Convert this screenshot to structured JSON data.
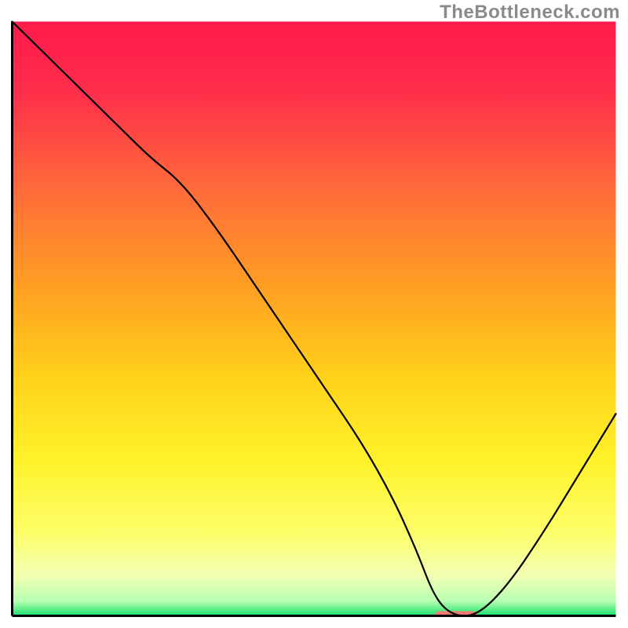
{
  "watermark": "TheBottleneck.com",
  "chart_data": {
    "type": "line",
    "title": "",
    "xlabel": "",
    "ylabel": "",
    "xlim": [
      0,
      100
    ],
    "ylim": [
      0,
      100
    ],
    "grid": false,
    "legend": false,
    "background_gradient_stops": [
      {
        "offset": 0.0,
        "color": "#ff1a4b"
      },
      {
        "offset": 0.12,
        "color": "#ff2e4b"
      },
      {
        "offset": 0.28,
        "color": "#ff6a3a"
      },
      {
        "offset": 0.45,
        "color": "#ffa022"
      },
      {
        "offset": 0.6,
        "color": "#ffd21a"
      },
      {
        "offset": 0.74,
        "color": "#fff22a"
      },
      {
        "offset": 0.86,
        "color": "#fdff6a"
      },
      {
        "offset": 0.93,
        "color": "#f4ffb0"
      },
      {
        "offset": 0.975,
        "color": "#b8ffb3"
      },
      {
        "offset": 1.0,
        "color": "#18e06a"
      }
    ],
    "series": [
      {
        "name": "bottleneck-curve",
        "color": "#000000",
        "stroke_width": 2.2,
        "x": [
          0,
          6,
          12,
          18,
          23,
          28,
          34,
          40,
          46,
          52,
          58,
          63,
          67,
          70,
          73,
          77,
          82,
          88,
          94,
          100
        ],
        "y": [
          100,
          94,
          88,
          82,
          77,
          73,
          65,
          56,
          47,
          38,
          29,
          20,
          11,
          3,
          0,
          0,
          5,
          14,
          24,
          34
        ]
      }
    ],
    "marker": {
      "name": "optimal-range",
      "color": "#ef7a74",
      "x_start": 70,
      "x_end": 77,
      "y": 0,
      "thickness_pct": 1.6
    },
    "axes_color": "#000000"
  }
}
